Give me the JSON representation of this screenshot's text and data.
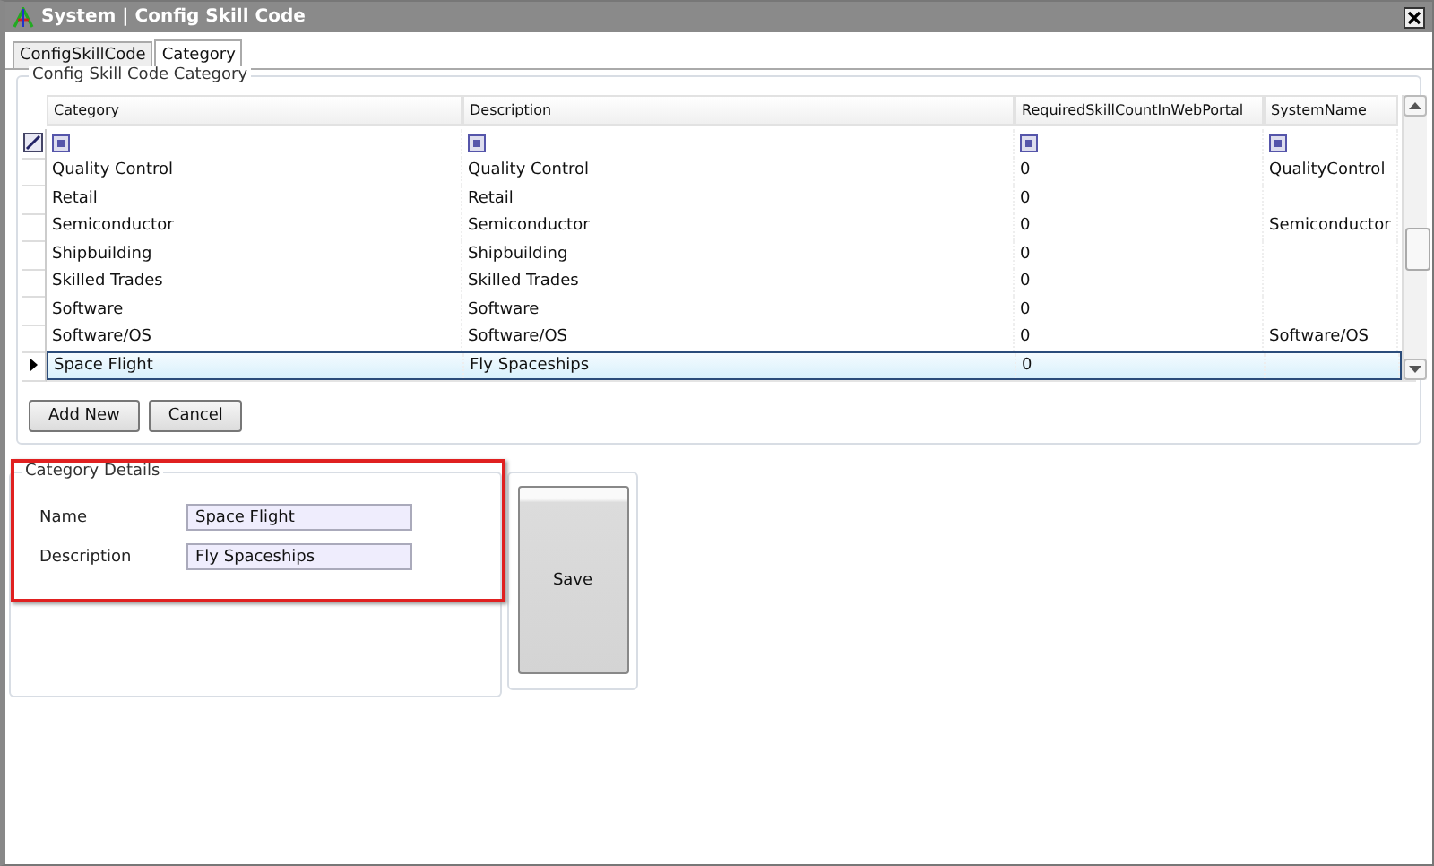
{
  "window": {
    "title": "System | Config Skill Code"
  },
  "tabs": [
    {
      "label": "ConfigSkillCode",
      "selected": false
    },
    {
      "label": "Category",
      "selected": true
    }
  ],
  "grid_group": {
    "title": "Config Skill Code Category"
  },
  "table": {
    "columns": [
      "Category",
      "Description",
      "RequiredSkillCountInWebPortal",
      "SystemName"
    ],
    "rows": [
      {
        "cells": [
          "Quality Control",
          "Quality Control",
          "0",
          "QualityControl"
        ],
        "selected": false
      },
      {
        "cells": [
          "Retail",
          "Retail",
          "0",
          ""
        ],
        "selected": false
      },
      {
        "cells": [
          "Semiconductor",
          "Semiconductor",
          "0",
          "Semiconductor"
        ],
        "selected": false
      },
      {
        "cells": [
          "Shipbuilding",
          "Shipbuilding",
          "0",
          ""
        ],
        "selected": false
      },
      {
        "cells": [
          "Skilled Trades",
          "Skilled Trades",
          "0",
          ""
        ],
        "selected": false
      },
      {
        "cells": [
          "Software",
          "Software",
          "0",
          ""
        ],
        "selected": false
      },
      {
        "cells": [
          "Software/OS",
          "Software/OS",
          "0",
          "Software/OS"
        ],
        "selected": false
      },
      {
        "cells": [
          "Space Flight",
          "Fly Spaceships",
          "0",
          ""
        ],
        "selected": true
      }
    ]
  },
  "buttons": [
    "Add New",
    "Cancel"
  ],
  "details": {
    "title": "Category Details",
    "fields": [
      {
        "label": "Name",
        "value": "Space Flight"
      },
      {
        "label": "Description",
        "value": "Fly Spaceships"
      }
    ]
  },
  "save_button": "Save"
}
